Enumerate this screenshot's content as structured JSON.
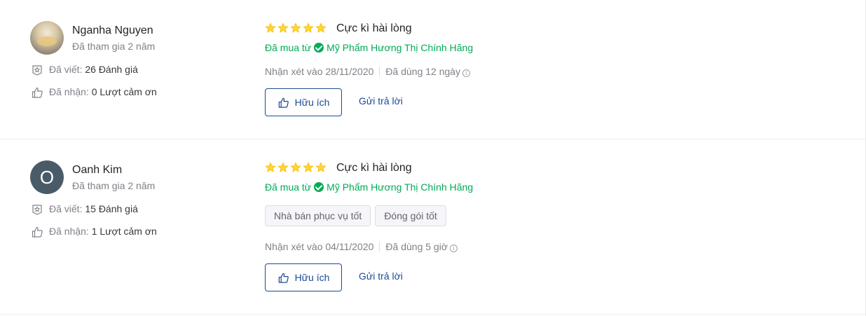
{
  "reviews": [
    {
      "user": {
        "name": "Nganha Nguyen",
        "joined": "Đã tham gia 2 năm",
        "avatar": "photo-avatar",
        "written_label": "Đã viết:",
        "written_value": "26 Đánh giá",
        "thanks_label": "Đã nhận:",
        "thanks_value": "0 Lượt cảm ơn"
      },
      "rating": 5,
      "title": "Cực kì hài lòng",
      "purchase_prefix": "Đã mua từ",
      "shop": "Mỹ Phẩm Hương Thị Chính Hãng",
      "tags": [],
      "reviewed_on": "Nhận xét vào 28/11/2020",
      "used_for": "Đã dùng 12 ngày",
      "helpful_label": "Hữu ích",
      "reply_label": "Gửi trả lời"
    },
    {
      "user": {
        "name": "Oanh Kim",
        "joined": "Đã tham gia 2 năm",
        "avatar_letter": "O",
        "written_label": "Đã viết:",
        "written_value": "15 Đánh giá",
        "thanks_label": "Đã nhận:",
        "thanks_value": "1 Lượt cảm ơn"
      },
      "rating": 5,
      "title": "Cực kì hài lòng",
      "purchase_prefix": "Đã mua từ",
      "shop": "Mỹ Phẩm Hương Thị Chính Hãng",
      "tags": [
        "Nhà bán phục vụ tốt",
        "Đóng gói tốt"
      ],
      "reviewed_on": "Nhận xét vào 04/11/2020",
      "used_for": "Đã dùng 5 giờ",
      "helpful_label": "Hữu ích",
      "reply_label": "Gửi trả lời"
    }
  ],
  "colors": {
    "star": "#fdd836",
    "verified_green": "#00ab56",
    "link_blue": "#1a4a94",
    "avatar_bg": "#4a5b68"
  },
  "icons": [
    "review-count-icon",
    "thumbs-up-icon",
    "star-icon",
    "verified-check-icon",
    "info-icon"
  ]
}
